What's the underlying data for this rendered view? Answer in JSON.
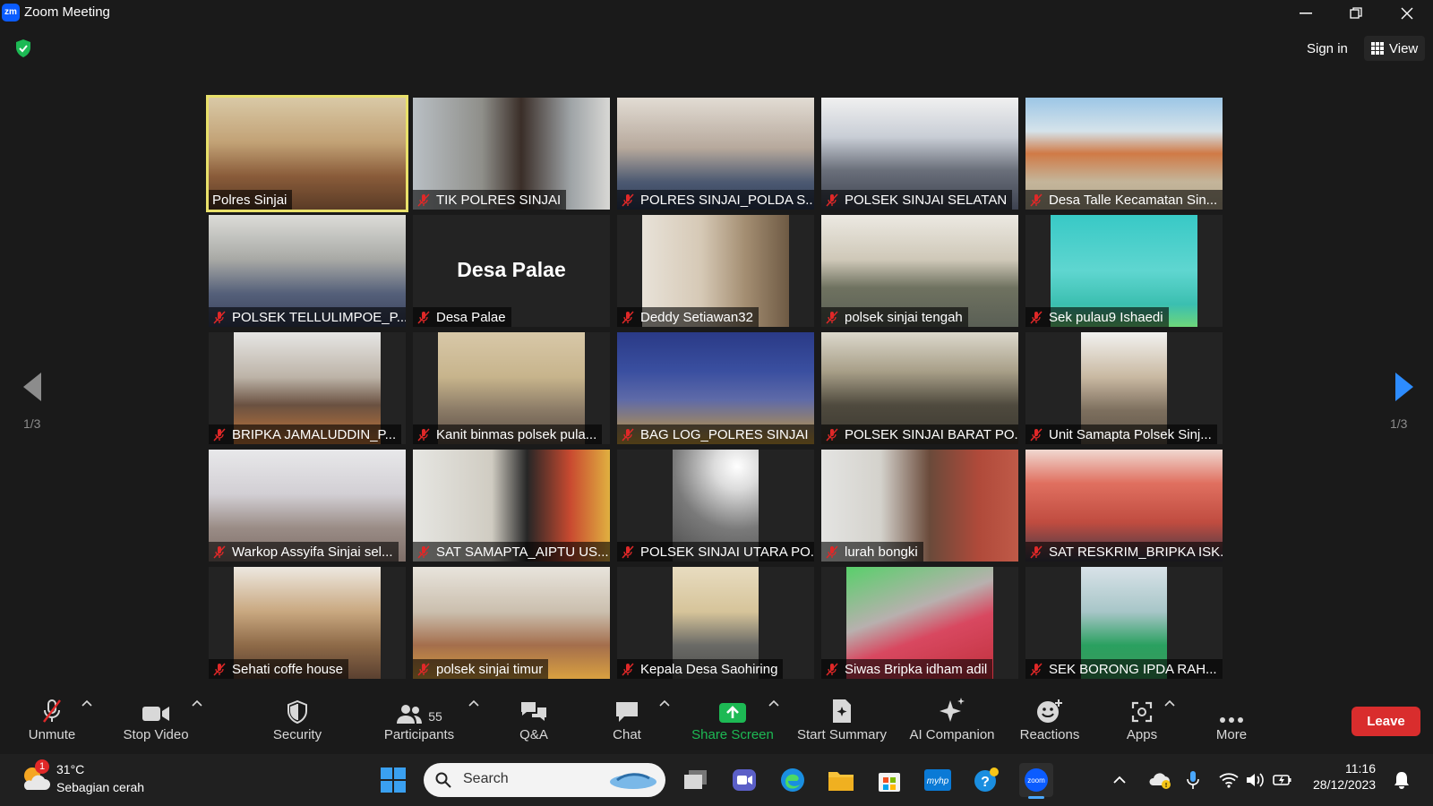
{
  "window": {
    "app_logo": "zm",
    "title": "Zoom Meeting"
  },
  "header": {
    "sign_in": "Sign in",
    "view": "View"
  },
  "pagination": {
    "left": "1/3",
    "right": "1/3"
  },
  "tiles": [
    {
      "name": "Polres Sinjai",
      "muted": false,
      "active": true
    },
    {
      "name": "TIK POLRES SINJAI",
      "muted": true
    },
    {
      "name": "POLRES SINJAI_POLDA S...",
      "muted": true
    },
    {
      "name": "POLSEK SINJAI SELATAN",
      "muted": true
    },
    {
      "name": "Desa Talle Kecamatan Sin...",
      "muted": true
    },
    {
      "name": "POLSEK TELLULIMPOE_P...",
      "muted": true
    },
    {
      "name": "Desa Palae",
      "muted": true,
      "display_name": "Desa Palae"
    },
    {
      "name": "Deddy Setiawan32",
      "muted": true
    },
    {
      "name": "polsek sinjai tengah",
      "muted": true
    },
    {
      "name": "Sek pulau9 Ishaedi",
      "muted": true
    },
    {
      "name": "BRIPKA JAMALUDDIN_P...",
      "muted": true
    },
    {
      "name": "Kanit binmas polsek pula...",
      "muted": true
    },
    {
      "name": "BAG LOG_POLRES SINJAI",
      "muted": true
    },
    {
      "name": "POLSEK SINJAI BARAT PO...",
      "muted": true
    },
    {
      "name": "Unit Samapta Polsek Sinj...",
      "muted": true
    },
    {
      "name": "Warkop Assyifa Sinjai sel...",
      "muted": true
    },
    {
      "name": "SAT SAMAPTA_AIPTU US...",
      "muted": true
    },
    {
      "name": "POLSEK SINJAI UTARA PO...",
      "muted": true
    },
    {
      "name": "lurah bongki",
      "muted": true
    },
    {
      "name": "SAT RESKRIM_BRIPKA ISK...",
      "muted": true
    },
    {
      "name": "Sehati coffe house",
      "muted": true
    },
    {
      "name": "polsek sinjai timur",
      "muted": true
    },
    {
      "name": "Kepala Desa Saohiring",
      "muted": true
    },
    {
      "name": "Siwas Bripka idham adil",
      "muted": true
    },
    {
      "name": "SEK BORONG IPDA RAH...",
      "muted": true
    }
  ],
  "toolbar": {
    "unmute": "Unmute",
    "stop_video": "Stop Video",
    "security": "Security",
    "participants": "Participants",
    "participants_count": "55",
    "qa": "Q&A",
    "chat": "Chat",
    "share_screen": "Share Screen",
    "start_summary": "Start Summary",
    "ai_companion": "AI Companion",
    "reactions": "Reactions",
    "apps": "Apps",
    "more": "More",
    "leave": "Leave"
  },
  "taskbar": {
    "weather_temp": "31°C",
    "weather_desc": "Sebagian cerah",
    "weather_badge": "1",
    "search_placeholder": "Search",
    "time": "11:16",
    "date": "28/12/2023"
  },
  "colors": {
    "accent_green": "#00c853",
    "active_border": "#e8e06a",
    "leave_red": "#d92d2d",
    "zoom_blue": "#0b5cff",
    "arrow_blue": "#2d8cff"
  }
}
